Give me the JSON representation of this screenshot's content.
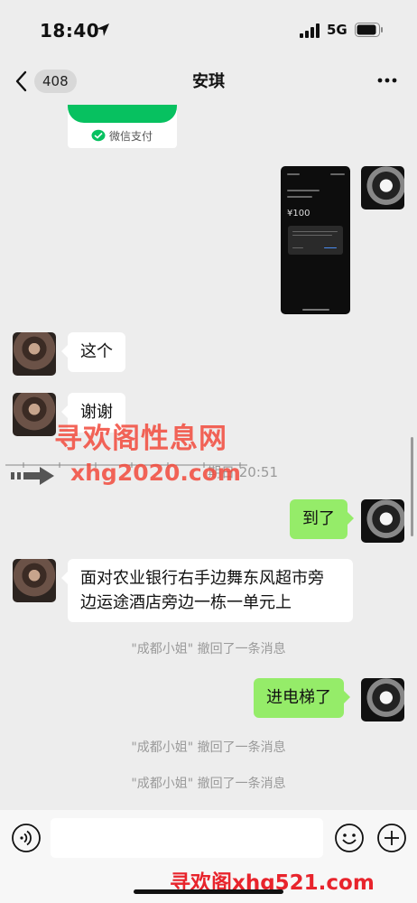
{
  "status": {
    "time": "18:40",
    "network": "5G"
  },
  "nav": {
    "unread_count": "408",
    "title": "安琪"
  },
  "messages": {
    "pay_card_label": "微信支付",
    "shot_amount": "¥100",
    "m1": "这个",
    "m2": "谢谢",
    "m3": "到了",
    "m4_line1": "面对农业银行右手边舞东风超市旁",
    "m4_line2": "边运途酒店旁边一栋一单元上",
    "recall1": "\"成都小姐\" 撤回了一条消息",
    "m5": "进电梯了",
    "recall2": "\"成都小姐\" 撤回了一条消息",
    "recall3": "\"成都小姐\" 撤回了一条消息",
    "time_partial": "期日 20:51"
  },
  "watermarks": {
    "w1": "寻欢阁性息网",
    "w2": "xhg2020.com",
    "w3": "寻欢阁xhg521.com"
  },
  "input": {
    "placeholder": ""
  },
  "colors": {
    "bubble_out": "#95ec69",
    "bubble_in": "#ffffff",
    "background": "#ededed",
    "wechat_green": "#07c160",
    "watermark_red": "#f24a3c"
  },
  "icons": [
    "location-arrow-icon",
    "signal-icon",
    "battery-icon",
    "back-chevron-icon",
    "more-dots-icon",
    "voice-icon",
    "emoji-icon",
    "plus-icon",
    "wechat-pay-icon"
  ]
}
